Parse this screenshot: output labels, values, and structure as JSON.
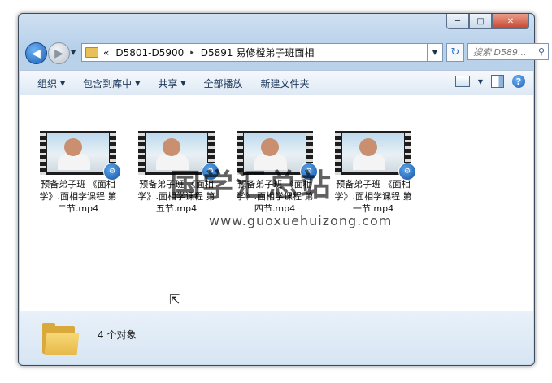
{
  "window": {
    "buttons": {
      "minimize": "─",
      "maximize": "□",
      "close": "✕"
    }
  },
  "nav": {
    "back_icon": "◀",
    "forward_icon": "▶",
    "breadcrumb": [
      "«",
      "D5801-D5900",
      "▸",
      "D5891 易修樘弟子班面相"
    ],
    "search_placeholder": "搜索 D589...",
    "refresh_icon": "↻",
    "search_icon": "⚲"
  },
  "toolbar": {
    "items": [
      "组织",
      "包含到库中",
      "共享",
      "全部播放",
      "新建文件夹"
    ],
    "help": "?"
  },
  "files": [
    {
      "name": "预备弟子班 《面相学》.面相学课程 第二节.mp4"
    },
    {
      "name": "预备弟子班 《面相学》.面相学课程 第五节.mp4"
    },
    {
      "name": "预备弟子班 《面相学》.面相学课程 第四节.mp4"
    },
    {
      "name": "预备弟子班 《面相学》.面相学课程 第一节.mp4"
    }
  ],
  "watermark": {
    "title": "国学汇总站",
    "url": "www.guoxuehuizong.com"
  },
  "status": {
    "count": "4 个对象"
  },
  "badge_icon": "⚙"
}
